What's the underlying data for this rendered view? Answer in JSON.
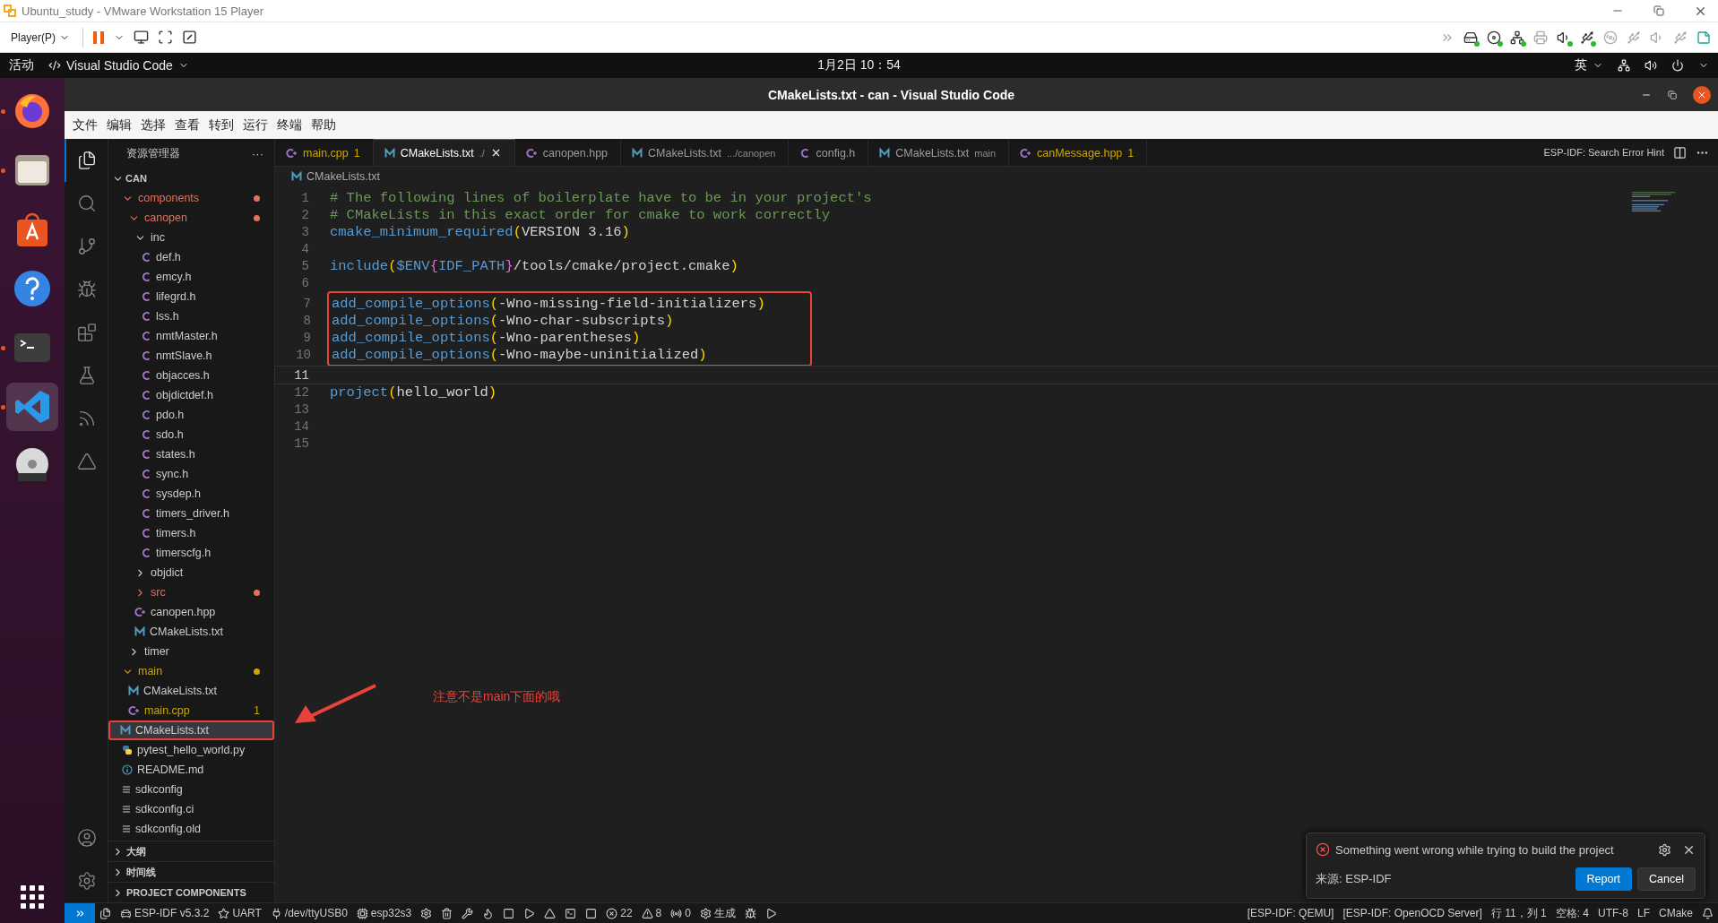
{
  "vm_window": {
    "title": "Ubuntu_study - VMware Workstation 15 Player"
  },
  "vm_toolbar": {
    "player_menu": "Player(P)",
    "devices": [
      {
        "kind": "more",
        "connected": false
      },
      {
        "kind": "disk",
        "connected": true
      },
      {
        "kind": "cd",
        "connected": true
      },
      {
        "kind": "network",
        "connected": true
      },
      {
        "kind": "printer",
        "connected": false
      },
      {
        "kind": "sound",
        "connected": true
      },
      {
        "kind": "usb",
        "connected": true
      },
      {
        "kind": "disc",
        "connected": false
      },
      {
        "kind": "usb",
        "connected": false
      },
      {
        "kind": "sound",
        "connected": false
      },
      {
        "kind": "usb",
        "connected": false
      },
      {
        "kind": "notes",
        "connected": false
      }
    ]
  },
  "ubuntu_bar": {
    "activities": "活动",
    "app_menu": "Visual Studio Code",
    "clock": "1月2日 10：54",
    "input_method": "英"
  },
  "dock": [
    {
      "kind": "firefox",
      "running": true,
      "selected": false
    },
    {
      "kind": "files",
      "running": true,
      "selected": false
    },
    {
      "kind": "appcenter",
      "running": false,
      "selected": false
    },
    {
      "kind": "help",
      "running": false,
      "selected": false
    },
    {
      "kind": "terminal",
      "running": true,
      "selected": false
    },
    {
      "kind": "vscode",
      "running": true,
      "selected": true
    },
    {
      "kind": "dvd",
      "running": false,
      "selected": false
    }
  ],
  "vscode": {
    "title": "CMakeLists.txt - can - Visual Studio Code",
    "menu": [
      "文件",
      "编辑",
      "选择",
      "查看",
      "转到",
      "运行",
      "终端",
      "帮助"
    ],
    "activity_bar": [
      {
        "kind": "explorer",
        "selected": true
      },
      {
        "kind": "search",
        "selected": false
      },
      {
        "kind": "scm",
        "selected": false
      },
      {
        "kind": "debug",
        "selected": false
      },
      {
        "kind": "extensions",
        "selected": false
      },
      {
        "kind": "testing",
        "selected": false
      },
      {
        "kind": "espressif",
        "selected": false
      },
      {
        "kind": "idf-web",
        "selected": false
      }
    ],
    "sidebar": {
      "title": "资源管理器",
      "more": "···",
      "root": "CAN",
      "tree": [
        {
          "name": "components",
          "kind": "folder",
          "expanded": true,
          "selected": false,
          "color": "#e2725b",
          "children": [
            {
              "name": "canopen",
              "kind": "folder",
              "expanded": true,
              "selected": false,
              "color": "#e2725b",
              "children": [
                {
                  "name": "inc",
                  "kind": "folder",
                  "expanded": true,
                  "selected": false,
                  "children": [
                    {
                      "name": "def.h",
                      "kind": "c",
                      "selected": false
                    },
                    {
                      "name": "emcy.h",
                      "kind": "c",
                      "selected": false
                    },
                    {
                      "name": "lifegrd.h",
                      "kind": "c",
                      "selected": false
                    },
                    {
                      "name": "lss.h",
                      "kind": "c",
                      "selected": false
                    },
                    {
                      "name": "nmtMaster.h",
                      "kind": "c",
                      "selected": false
                    },
                    {
                      "name": "nmtSlave.h",
                      "kind": "c",
                      "selected": false
                    },
                    {
                      "name": "objacces.h",
                      "kind": "c",
                      "selected": false
                    },
                    {
                      "name": "objdictdef.h",
                      "kind": "c",
                      "selected": false
                    },
                    {
                      "name": "pdo.h",
                      "kind": "c",
                      "selected": false
                    },
                    {
                      "name": "sdo.h",
                      "kind": "c",
                      "selected": false
                    },
                    {
                      "name": "states.h",
                      "kind": "c",
                      "selected": false
                    },
                    {
                      "name": "sync.h",
                      "kind": "c",
                      "selected": false
                    },
                    {
                      "name": "sysdep.h",
                      "kind": "c",
                      "selected": false
                    },
                    {
                      "name": "timers_driver.h",
                      "kind": "c",
                      "selected": false
                    },
                    {
                      "name": "timers.h",
                      "kind": "c",
                      "selected": false
                    },
                    {
                      "name": "timerscfg.h",
                      "kind": "c",
                      "selected": false
                    }
                  ]
                },
                {
                  "name": "objdict",
                  "kind": "folder",
                  "expanded": false,
                  "selected": false
                },
                {
                  "name": "src",
                  "kind": "folder",
                  "expanded": false,
                  "selected": false,
                  "color": "#e2725b"
                },
                {
                  "name": "canopen.hpp",
                  "kind": "cpp",
                  "selected": false
                },
                {
                  "name": "CMakeLists.txt",
                  "kind": "cmake",
                  "selected": false
                }
              ]
            },
            {
              "name": "timer",
              "kind": "folder",
              "expanded": false,
              "selected": false
            }
          ]
        },
        {
          "name": "main",
          "kind": "folder",
          "expanded": true,
          "selected": false,
          "color": "#cca700",
          "children": [
            {
              "name": "CMakeLists.txt",
              "kind": "cmake",
              "selected": false
            },
            {
              "name": "main.cpp",
              "kind": "cpp",
              "selected": false,
              "color": "#cca700",
              "badge": "1"
            }
          ]
        },
        {
          "name": "CMakeLists.txt",
          "kind": "cmake",
          "selected": true,
          "boxed": true
        },
        {
          "name": "pytest_hello_world.py",
          "kind": "python",
          "selected": false
        },
        {
          "name": "README.md",
          "kind": "info",
          "selected": false
        },
        {
          "name": "sdkconfig",
          "kind": "config",
          "selected": false
        },
        {
          "name": "sdkconfig.ci",
          "kind": "config",
          "selected": false
        },
        {
          "name": "sdkconfig.old",
          "kind": "config",
          "selected": false
        }
      ],
      "sections": [
        "大纲",
        "时间线",
        "PROJECT COMPONENTS"
      ]
    },
    "tabs": [
      {
        "label": "main.cpp",
        "kind": "cpp",
        "badge": "1",
        "color": "#cca700",
        "selected": false
      },
      {
        "label": "CMakeLists.txt",
        "description": "./",
        "kind": "cmake",
        "selected": true
      },
      {
        "label": "canopen.hpp",
        "kind": "cpp",
        "selected": false
      },
      {
        "label": "CMakeLists.txt",
        "description": ".../canopen",
        "kind": "cmake",
        "selected": false
      },
      {
        "label": "config.h",
        "kind": "c",
        "selected": false
      },
      {
        "label": "CMakeLists.txt",
        "description": "main",
        "kind": "cmake",
        "selected": false
      },
      {
        "label": "canMessage.hpp",
        "kind": "cpp",
        "badge": "1",
        "color": "#cca700",
        "selected": false
      }
    ],
    "editor_hint": "ESP-IDF: Search Error Hint",
    "breadcrumb": "CMakeLists.txt",
    "lines": [
      {
        "number": "1",
        "current": false,
        "boxed": false,
        "tokens": [
          {
            "kind": "comment",
            "text": "# The following lines of boilerplate have to be in your project's"
          }
        ]
      },
      {
        "number": "2",
        "current": false,
        "boxed": false,
        "tokens": [
          {
            "kind": "comment",
            "text": "# CMakeLists in this exact order for cmake to work correctly"
          }
        ]
      },
      {
        "number": "3",
        "current": false,
        "boxed": false,
        "tokens": [
          {
            "kind": "func",
            "text": "cmake_minimum_required"
          },
          {
            "kind": "paren",
            "text": "("
          },
          {
            "kind": "plain",
            "text": "VERSION 3.16"
          },
          {
            "kind": "paren",
            "text": ")"
          }
        ]
      },
      {
        "number": "4",
        "current": false,
        "boxed": false
      },
      {
        "number": "5",
        "current": false,
        "boxed": false,
        "tokens": [
          {
            "kind": "func",
            "text": "include"
          },
          {
            "kind": "paren",
            "text": "("
          },
          {
            "kind": "var",
            "text": "$ENV"
          },
          {
            "kind": "brace",
            "text": "{"
          },
          {
            "kind": "var",
            "text": "IDF_PATH"
          },
          {
            "kind": "brace",
            "text": "}"
          },
          {
            "kind": "plain",
            "text": "/tools/cmake/project.cmake"
          },
          {
            "kind": "paren",
            "text": ")"
          }
        ]
      },
      {
        "number": "6",
        "current": false,
        "boxed": false
      },
      {
        "number": "7",
        "current": false,
        "boxed": true,
        "tokens": [
          {
            "kind": "func",
            "text": "add_compile_options"
          },
          {
            "kind": "paren",
            "text": "("
          },
          {
            "kind": "plain",
            "text": "-Wno-missing-field-initializers"
          },
          {
            "kind": "paren",
            "text": ")"
          }
        ]
      },
      {
        "number": "8",
        "current": false,
        "boxed": true,
        "tokens": [
          {
            "kind": "func",
            "text": "add_compile_options"
          },
          {
            "kind": "paren",
            "text": "("
          },
          {
            "kind": "plain",
            "text": "-Wno-char-subscripts"
          },
          {
            "kind": "paren",
            "text": ")"
          }
        ]
      },
      {
        "number": "9",
        "current": false,
        "boxed": true,
        "tokens": [
          {
            "kind": "func",
            "text": "add_compile_options"
          },
          {
            "kind": "paren",
            "text": "("
          },
          {
            "kind": "plain",
            "text": "-Wno-parentheses"
          },
          {
            "kind": "paren",
            "text": ")"
          }
        ]
      },
      {
        "number": "10",
        "current": false,
        "boxed": true,
        "tokens": [
          {
            "kind": "func",
            "text": "add_compile_options"
          },
          {
            "kind": "paren",
            "text": "("
          },
          {
            "kind": "plain",
            "text": "-Wno-maybe-uninitialized"
          },
          {
            "kind": "paren",
            "text": ")"
          }
        ]
      },
      {
        "number": "11",
        "current": true,
        "boxed": false
      },
      {
        "number": "12",
        "current": false,
        "boxed": false,
        "tokens": [
          {
            "kind": "func",
            "text": "project"
          },
          {
            "kind": "paren",
            "text": "("
          },
          {
            "kind": "plain",
            "text": "hello_world"
          },
          {
            "kind": "paren",
            "text": ")"
          }
        ]
      },
      {
        "number": "13",
        "current": false,
        "boxed": false
      },
      {
        "number": "14",
        "current": false,
        "boxed": false
      },
      {
        "number": "15",
        "current": false,
        "boxed": false
      }
    ],
    "annotation_note": "注意不是main下面的哦",
    "notification": {
      "message": "Something went wrong while trying to build the project",
      "source": "来源: ESP-IDF",
      "buttons": [
        "Report",
        "Cancel"
      ]
    },
    "status_bar": {
      "left": [
        {
          "kind": "files"
        },
        {
          "kind": "device",
          "text": "ESP-IDF v5.3.2"
        },
        {
          "kind": "star",
          "text": "UART"
        },
        {
          "kind": "plug",
          "text": "/dev/ttyUSB0"
        },
        {
          "kind": "chip",
          "text": "esp32s3"
        },
        {
          "kind": "gear"
        },
        {
          "kind": "trash"
        },
        {
          "kind": "wrench"
        },
        {
          "kind": "flame"
        },
        {
          "kind": "square"
        },
        {
          "kind": "play"
        },
        {
          "kind": "triangle"
        },
        {
          "kind": "terminal"
        },
        {
          "kind": "square"
        },
        {
          "kind": "error",
          "text": "22"
        },
        {
          "kind": "warning",
          "text": "8"
        },
        {
          "kind": "broadcast",
          "text": "0"
        },
        {
          "kind": "gear",
          "text": "生成"
        },
        {
          "kind": "bug"
        },
        {
          "kind": "play"
        }
      ],
      "right": [
        {
          "text": "[ESP-IDF: QEMU]"
        },
        {
          "text": "[ESP-IDF: OpenOCD Server]"
        },
        {
          "text": "行 11，列 1"
        },
        {
          "text": "空格: 4"
        },
        {
          "text": "UTF-8"
        },
        {
          "text": "LF"
        },
        {
          "text": "CMake"
        },
        {
          "kind": "bell"
        }
      ]
    }
  }
}
